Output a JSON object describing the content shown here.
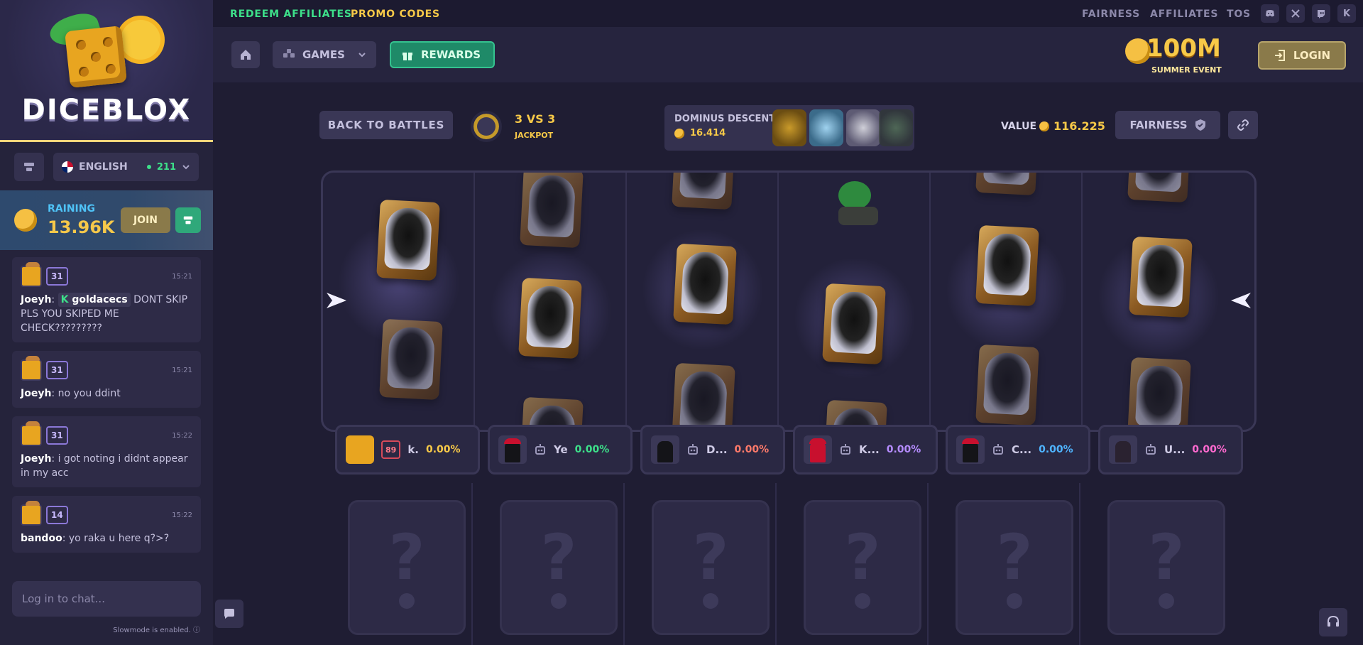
{
  "brand": {
    "name": "DICEBLOX"
  },
  "topbar": {
    "left_links": [
      {
        "label": "REDEEM AFFILIATES",
        "color": "#3de08a"
      },
      {
        "label": "PROMO CODES",
        "color": "#f7c948"
      }
    ],
    "right_links": [
      "FAIRNESS",
      "AFFILIATES",
      "TOS"
    ],
    "social_icons": [
      "discord-icon",
      "x-icon",
      "twitch-icon",
      "kick-icon"
    ],
    "kick_glyph": "K"
  },
  "nav": {
    "games_label": "GAMES",
    "rewards_label": "REWARDS",
    "event_amount": "100M",
    "event_label": "SUMMER EVENT",
    "login_label": "LOGIN"
  },
  "sidebar": {
    "language": "ENGLISH",
    "online_count": "211",
    "rain": {
      "label": "RAINING",
      "amount": "13.96K",
      "join_label": "JOIN"
    },
    "messages": [
      {
        "level": "31",
        "time": "15:21",
        "user": "Joeyh",
        "mention": "goldacecs",
        "text": "DONT SKIP PLS YOU SKIPED ME CHECK?????????"
      },
      {
        "level": "31",
        "time": "15:21",
        "user": "Joeyh",
        "text": "no you ddint"
      },
      {
        "level": "31",
        "time": "15:22",
        "user": "Joeyh",
        "text": "i got noting i didnt appear in my acc"
      },
      {
        "level": "14",
        "time": "15:22",
        "user": "bandoo",
        "text": "yo raka u here q?>?"
      }
    ],
    "chat_placeholder": "Log in to chat...",
    "slowmode_text": "Slowmode is enabled."
  },
  "battle": {
    "back_label": "BACK TO BATTLES",
    "mode_title": "3 VS 3",
    "mode_sub": "JACKPOT",
    "case_name": "DOMINUS DESCENTS",
    "case_price": "16.414",
    "value_label": "VALUE",
    "value_amount": "116.225",
    "fairness_label": "FAIRNESS",
    "players": [
      {
        "name": "k.",
        "pct": "0.00%",
        "pct_color": "#f7c948",
        "level": "89",
        "bot": false
      },
      {
        "name": "Ye",
        "pct": "0.00%",
        "pct_color": "#3de08a",
        "bot": true
      },
      {
        "name": "D...",
        "pct": "0.00%",
        "pct_color": "#ff7a6a",
        "bot": true
      },
      {
        "name": "K...",
        "pct": "0.00%",
        "pct_color": "#b58cff",
        "bot": true
      },
      {
        "name": "C...",
        "pct": "0.00%",
        "pct_color": "#4fb4ff",
        "bot": true
      },
      {
        "name": "U...",
        "pct": "0.00%",
        "pct_color": "#ff6ad0",
        "bot": true
      }
    ],
    "unknown_glyph": "?"
  },
  "colors": {
    "accent_green": "#3de08a",
    "gold": "#f7c948",
    "bg": "#1f1d33"
  }
}
